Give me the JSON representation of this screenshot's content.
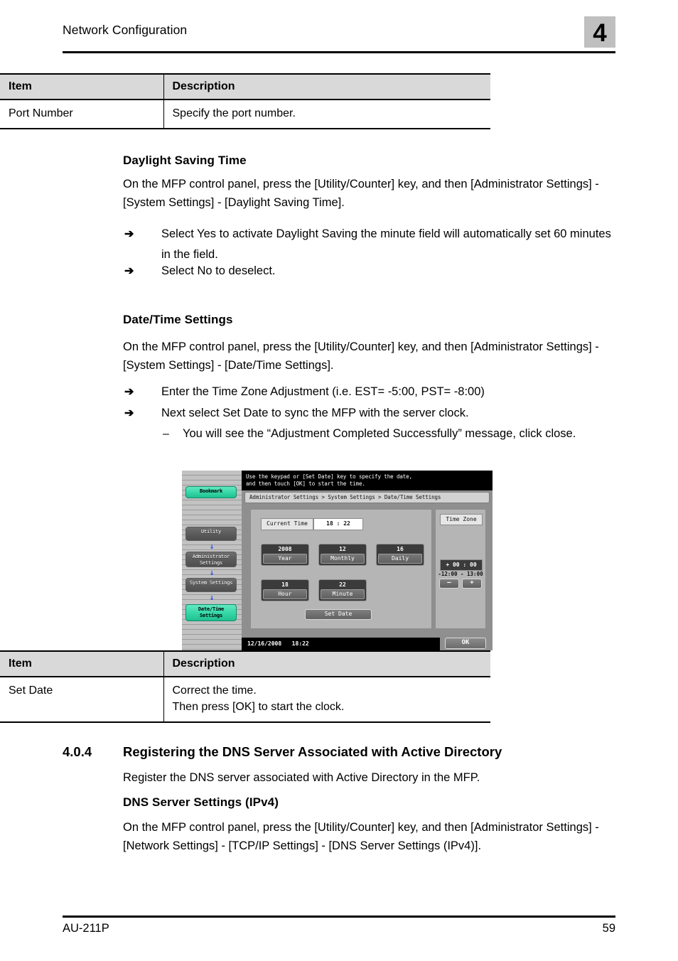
{
  "header": {
    "title": "Network Configuration",
    "chapter": "4"
  },
  "tables": {
    "port": {
      "columns": [
        "Item",
        "Description"
      ],
      "rows": [
        {
          "item": "Port Number",
          "description": "Specify the port number."
        }
      ]
    },
    "set_date": {
      "columns": [
        "Item",
        "Description"
      ],
      "rows": [
        {
          "item": "Set Date",
          "description": "Correct the time.\nThen press [OK] to start the clock."
        }
      ]
    }
  },
  "daylight_saving": {
    "heading": "Daylight Saving Time",
    "paragraph": "On the MFP control panel, press the [Utility/Counter] key, and then [Administrator Settings] - [System Settings] - [Daylight Saving Time].",
    "bullets": [
      "Select Yes to activate Daylight Saving the minute field will automatically set 60 minutes in the field.",
      "Select No to deselect."
    ],
    "bullet_mark": "➔"
  },
  "date_time": {
    "heading": "Date/Time Settings",
    "paragraph": "On the MFP control panel, press the [Utility/Counter] key, and then [Administrator Settings] - [System Settings] - [Date/Time Settings].",
    "bullets": [
      "Enter the Time Zone Adjustment (i.e. EST= -5:00, PST= -8:00)",
      "Next select Set Date to sync the MFP with the server clock."
    ],
    "sub_bullet": "You will see the “Adjustment Completed Successfully” message, click close.",
    "bullet_mark": "➔",
    "dash_mark": "–"
  },
  "section_404": {
    "number": "4.0.4",
    "title": "Registering the DNS Server Associated with Active Directory",
    "paragraph": "Register the DNS server associated with Active Directory in the MFP.",
    "sub_heading": "DNS Server Settings (IPv4)",
    "sub_paragraph": "On the MFP control panel, press the [Utility/Counter] key, and then [Administrator Settings] - [Network Settings] - [TCP/IP Settings] - [DNS Server Settings (IPv4)]."
  },
  "mfp_panel": {
    "message": "Use the keypad or [Set Date] key to specify the date,\nand then touch [OK] to start the time.",
    "breadcrumb": "Administrator Settings > System Settings > Date/Time Settings",
    "rail": {
      "bookmark": "Bookmark",
      "utility": "Utility",
      "administrator": "Administrator\nSettings",
      "system": "System Settings",
      "datetime": "Date/Time\nSettings",
      "arrow": "↓",
      "accent_green": "#34d6a6",
      "arrow_color": "#2a4fe0"
    },
    "current_time": {
      "label": "Current Time",
      "value": "18 : 22"
    },
    "fields": [
      {
        "value": "2008",
        "label": "Year"
      },
      {
        "value": "12",
        "label": "Monthly"
      },
      {
        "value": "16",
        "label": "Daily"
      },
      {
        "value": "18",
        "label": "Hour"
      },
      {
        "value": "22",
        "label": "Minute"
      }
    ],
    "set_date_button": "Set Date",
    "time_zone": {
      "title": "Time Zone",
      "value": "+ 00 : 00",
      "range": "-12:00  -  13:00",
      "minus": "–",
      "plus": "+"
    },
    "status": {
      "date": "12/16/2008",
      "time": "18:22"
    },
    "ok_button": "OK"
  },
  "footer": {
    "left": "AU-211P",
    "right": "59"
  }
}
